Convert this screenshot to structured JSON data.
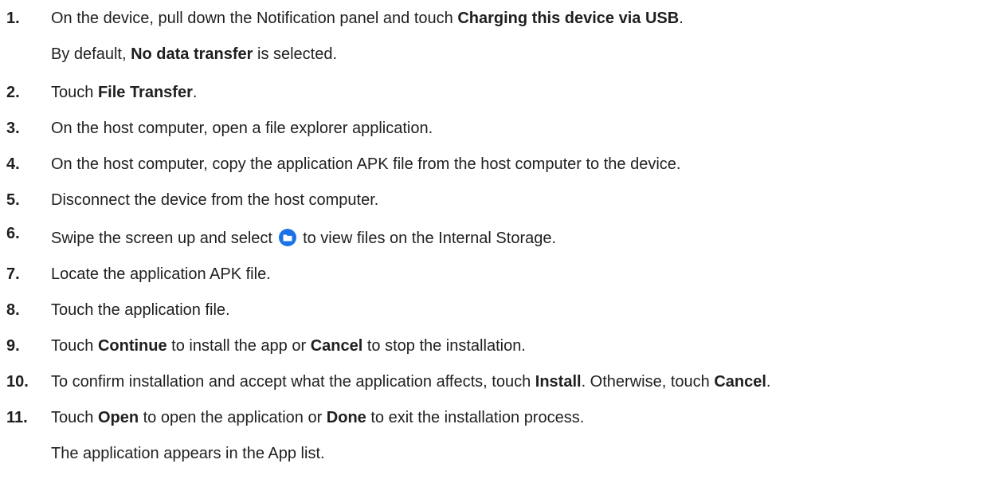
{
  "steps": [
    {
      "num": "1.",
      "parts": [
        "On the device, pull down the Notification panel and touch ",
        "Charging this device via USB",
        "."
      ],
      "note_parts": [
        "By default, ",
        "No data transfer",
        " is selected."
      ]
    },
    {
      "num": "2.",
      "parts": [
        "Touch ",
        "File Transfer",
        "."
      ]
    },
    {
      "num": "3.",
      "text": "On the host computer, open a file explorer application."
    },
    {
      "num": "4.",
      "text": "On the host computer, copy the application APK file from the host computer to the device."
    },
    {
      "num": "5.",
      "text": "Disconnect the device from the host computer."
    },
    {
      "num": "6.",
      "parts": [
        "Swipe the screen up and select ",
        " to view files on the Internal Storage."
      ],
      "icon": "files-folder-icon",
      "icon_color": "#1a73e8"
    },
    {
      "num": "7.",
      "text": "Locate the application APK file."
    },
    {
      "num": "8.",
      "text": "Touch the application file."
    },
    {
      "num": "9.",
      "parts": [
        "Touch ",
        "Continue",
        " to install the app or ",
        "Cancel",
        " to stop the installation."
      ]
    },
    {
      "num": "10.",
      "parts": [
        "To confirm installation and accept what the application affects, touch ",
        "Install",
        ". Otherwise, touch ",
        "Cancel",
        "."
      ]
    },
    {
      "num": "11.",
      "parts": [
        "Touch ",
        "Open",
        " to open the application or ",
        "Done",
        " to exit the installation process."
      ],
      "note": "The application appears in the App list."
    }
  ]
}
